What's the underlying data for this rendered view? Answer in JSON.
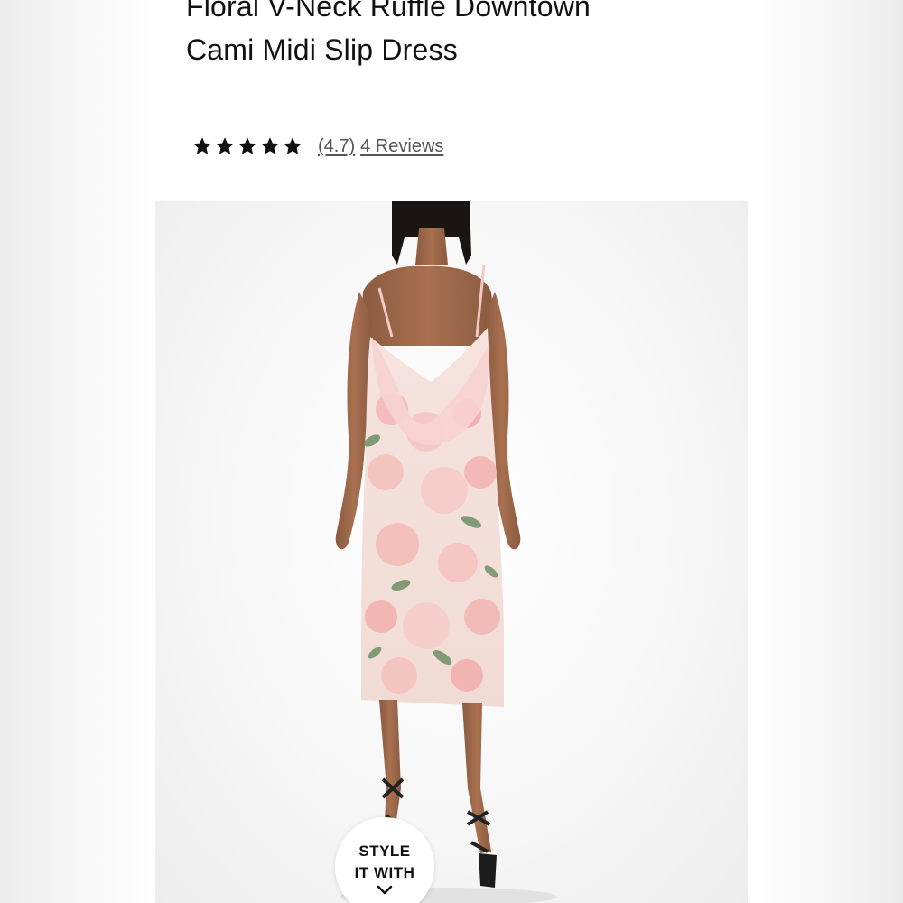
{
  "product": {
    "title_line1": "Floral V-Neck Ruffle Downtown",
    "title_line2": "Cami Midi Slip Dress"
  },
  "rating": {
    "stars": 5,
    "score_text": "(4.7)",
    "reviews_text": "4 Reviews",
    "icon": "star-icon",
    "star_color": "#111111"
  },
  "style_button": {
    "line1": "STYLE",
    "line2": "IT WITH",
    "icon": "chevron-down-icon"
  },
  "colors": {
    "dress_pink": "#f2b7b5",
    "leaf_green": "#6f8f66",
    "background": "#ffffff"
  }
}
